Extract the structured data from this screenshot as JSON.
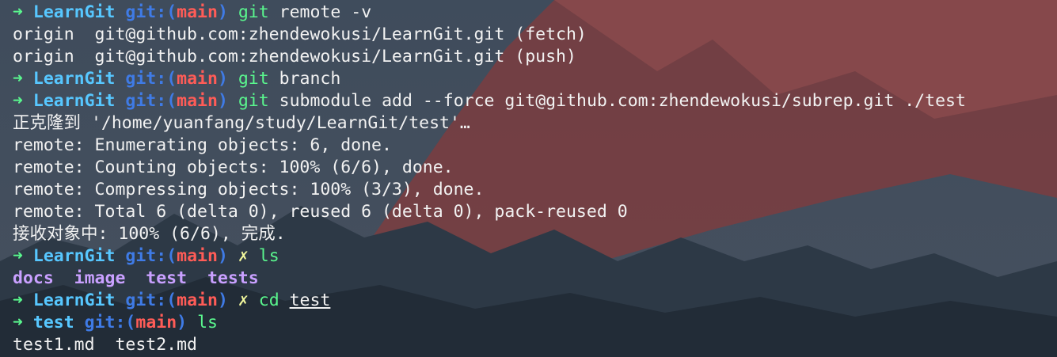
{
  "terminal": {
    "blocks": [
      {
        "prompt": {
          "dir": "LearnGit",
          "git": "git:(",
          "branch": "main",
          "close": ")",
          "dirty": ""
        },
        "cmd": "git",
        "args": "remote -v"
      },
      {
        "out": "origin  git@github.com:zhendewokusi/LearnGit.git (fetch)"
      },
      {
        "out": "origin  git@github.com:zhendewokusi/LearnGit.git (push)"
      },
      {
        "prompt": {
          "dir": "LearnGit",
          "git": "git:(",
          "branch": "main",
          "close": ")",
          "dirty": ""
        },
        "cmd": "git",
        "args": "branch"
      },
      {
        "prompt": {
          "dir": "LearnGit",
          "git": "git:(",
          "branch": "main",
          "close": ")",
          "dirty": ""
        },
        "cmd": "git",
        "args": "submodule add --force git@github.com:zhendewokusi/subrep.git ./test"
      },
      {
        "out": "正克隆到 '/home/yuanfang/study/LearnGit/test'…"
      },
      {
        "out": "remote: Enumerating objects: 6, done."
      },
      {
        "out": "remote: Counting objects: 100% (6/6), done."
      },
      {
        "out": "remote: Compressing objects: 100% (3/3), done."
      },
      {
        "out": "remote: Total 6 (delta 0), reused 6 (delta 0), pack-reused 0"
      },
      {
        "out": "接收对象中: 100% (6/6), 完成."
      },
      {
        "prompt": {
          "dir": "LearnGit",
          "git": "git:(",
          "branch": "main",
          "close": ")",
          "dirty": "✗"
        },
        "cmd": "ls",
        "args": ""
      },
      {
        "dirlist": [
          "docs",
          "image",
          "test",
          "tests"
        ]
      },
      {
        "prompt": {
          "dir": "LearnGit",
          "git": "git:(",
          "branch": "main",
          "close": ")",
          "dirty": "✗"
        },
        "cmd": "cd",
        "args_ul": "test"
      },
      {
        "prompt": {
          "dir": "test",
          "git": "git:(",
          "branch": "main",
          "close": ")",
          "dirty": ""
        },
        "cmd": "ls",
        "args": ""
      },
      {
        "out": "test1.md  test2.md"
      }
    ],
    "prompt_arrow": "➜"
  },
  "colors": {
    "sky": "#3d4a5a",
    "mountain": "#8a3f3f",
    "forest": "#23303c",
    "prompt_arrow": "#5af78e",
    "dir": "#57c7ff",
    "branch": "#ff5c57",
    "command": "#5af78e",
    "dir_listing": "#c9a0ff"
  },
  "background": {
    "icon": "mountain-forest-wallpaper"
  }
}
